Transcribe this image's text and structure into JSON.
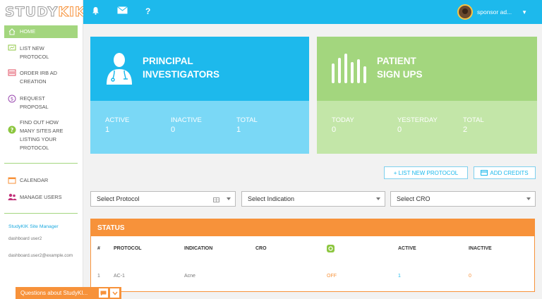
{
  "logo": {
    "a": "STUDY",
    "b": "KIK"
  },
  "topbar": {
    "user_name": "sponsor ad..."
  },
  "sidebar": {
    "items": [
      {
        "label": "HOME"
      },
      {
        "label": "LIST NEW PROTOCOL"
      },
      {
        "label": "ORDER IRB AD CREATION"
      },
      {
        "label": "REQUEST PROPOSAL"
      },
      {
        "label": "FIND OUT HOW MANY SITES ARE LISTING YOUR PROTOCOL"
      },
      {
        "label": "CALENDAR"
      },
      {
        "label": "MANAGE USERS"
      }
    ],
    "manager_title": "StudyKIK Site Manager",
    "user_name": "dashboard user2",
    "user_email": "dashboard.user2@example.com"
  },
  "cards": {
    "investigators": {
      "title_line1": "PRINCIPAL",
      "title_line2": "INVESTIGATORS",
      "stats": [
        {
          "label": "ACTIVE",
          "value": "1"
        },
        {
          "label": "INACTIVE",
          "value": "0"
        },
        {
          "label": "TOTAL",
          "value": "1"
        }
      ]
    },
    "signups": {
      "title_line1": "PATIENT",
      "title_line2": "SIGN UPS",
      "stats": [
        {
          "label": "TODAY",
          "value": "0"
        },
        {
          "label": "YESTERDAY",
          "value": "0"
        },
        {
          "label": "TOTAL",
          "value": "2"
        }
      ]
    }
  },
  "actions": {
    "list_protocol": "+ LIST NEW PROTOCOL",
    "add_credits": "ADD CREDITS"
  },
  "filters": {
    "protocol": "Select Protocol",
    "indication": "Select Indication",
    "cro": "Select CRO"
  },
  "status": {
    "title": "STATUS",
    "columns": [
      "#",
      "PROTOCOL",
      "INDICATION",
      "CRO",
      "",
      "ACTIVE",
      "INACTIVE"
    ],
    "row": {
      "num": "1",
      "protocol": "AC-1",
      "indication": "Acne",
      "cro": "",
      "state": "OFF",
      "active": "1",
      "inactive": "0"
    }
  },
  "chat": {
    "label": "Questions about StudyKI..."
  },
  "colors": {
    "primary": "#1db9ec",
    "green": "#a3d67e",
    "orange": "#f7923a"
  }
}
